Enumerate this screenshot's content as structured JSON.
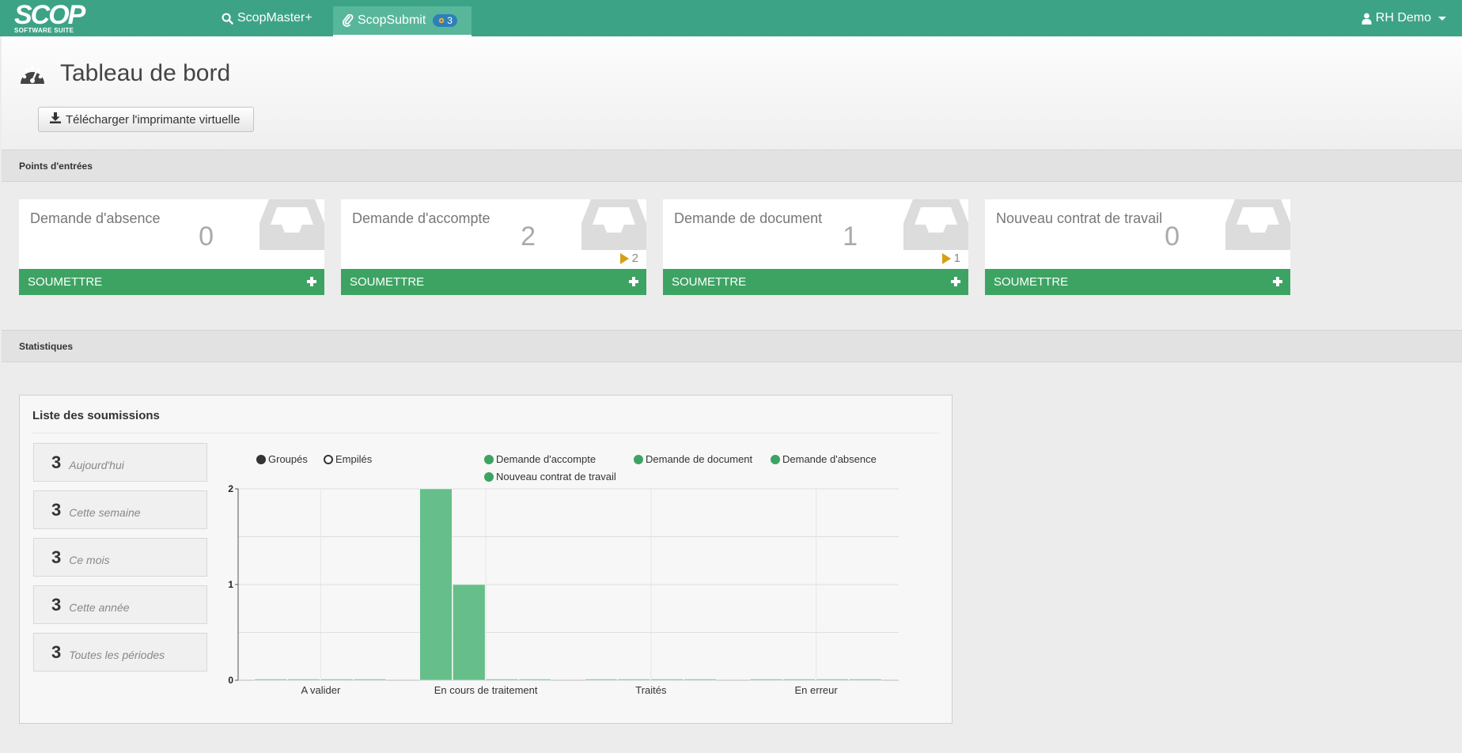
{
  "navbar": {
    "logo_text": "SCOP",
    "logo_sub": "SOFTWARE SUITE",
    "scopmaster_label": "ScopMaster+",
    "scopsubmit_label": "ScopSubmit",
    "scopsubmit_badge": "3",
    "user_label": "RH Demo"
  },
  "page": {
    "title": "Tableau de bord",
    "download_button": "Télécharger l'imprimante virtuelle"
  },
  "sections": {
    "entries": "Points d'entrées",
    "stats": "Statistiques"
  },
  "cards": [
    {
      "title": "Demande d'absence",
      "count": "0",
      "flag": "",
      "submit": "SOUMETTRE"
    },
    {
      "title": "Demande d'accompte",
      "count": "2",
      "flag": "2",
      "submit": "SOUMETTRE"
    },
    {
      "title": "Demande de document",
      "count": "1",
      "flag": "1",
      "submit": "SOUMETTRE"
    },
    {
      "title": "Nouveau contrat de travail",
      "count": "0",
      "flag": "",
      "submit": "SOUMETTRE"
    }
  ],
  "panel": {
    "title": "Liste des soumissions",
    "stats": [
      {
        "value": "3",
        "label": "Aujourd'hui"
      },
      {
        "value": "3",
        "label": "Cette semaine"
      },
      {
        "value": "3",
        "label": "Ce mois"
      },
      {
        "value": "3",
        "label": "Cette année"
      },
      {
        "value": "3",
        "label": "Toutes les périodes"
      }
    ]
  },
  "colors": {
    "navbar": "#3da386",
    "submit": "#3da363",
    "bar": "#66bf8a",
    "flag": "#d4a017"
  },
  "chart_data": {
    "type": "bar",
    "mode_options": [
      "Groupés",
      "Empilés"
    ],
    "mode_selected": "Groupés",
    "categories": [
      "A valider",
      "En cours de traitement",
      "Traités",
      "En erreur"
    ],
    "series": [
      {
        "name": "Demande d'accompte",
        "values": [
          0,
          2,
          0,
          0
        ],
        "color": "#3da363"
      },
      {
        "name": "Demande de document",
        "values": [
          0,
          1,
          0,
          0
        ],
        "color": "#3da363"
      },
      {
        "name": "Demande d'absence",
        "values": [
          0,
          0,
          0,
          0
        ],
        "color": "#3da363"
      },
      {
        "name": "Nouveau contrat de travail",
        "values": [
          0,
          0,
          0,
          0
        ],
        "color": "#3da363"
      }
    ],
    "yticks": [
      0,
      1,
      2
    ],
    "ylim": [
      0,
      2
    ],
    "grid": true,
    "legend_position": "top"
  }
}
